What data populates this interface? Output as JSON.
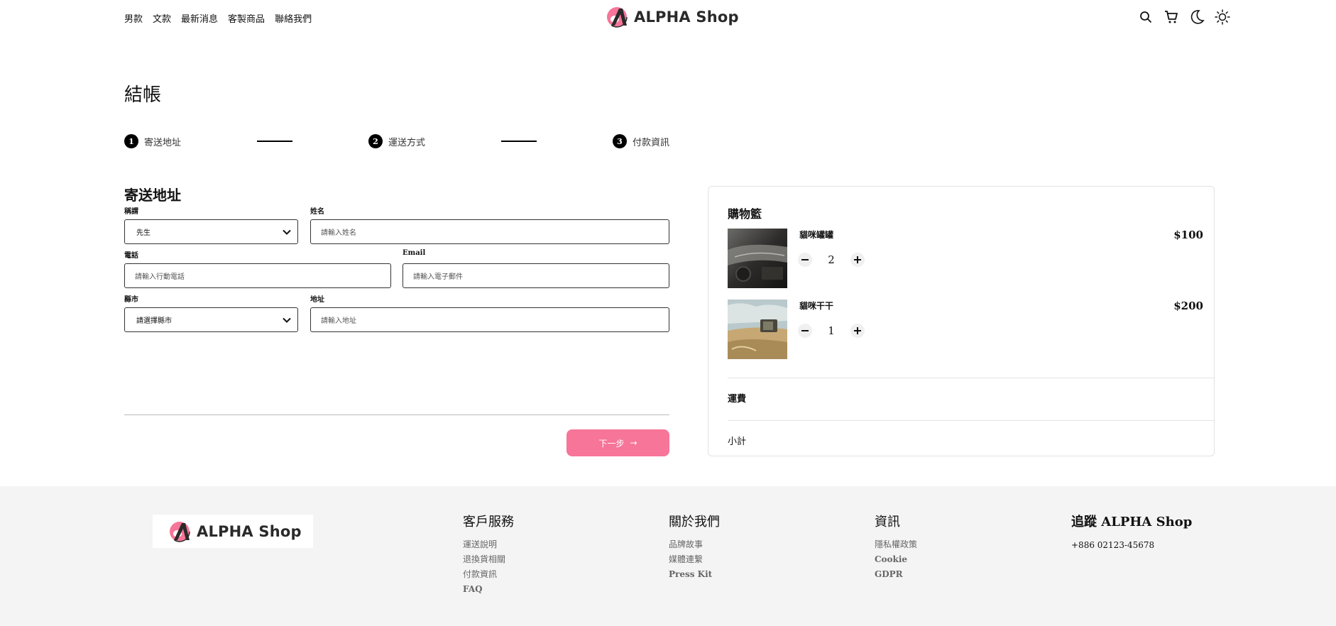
{
  "header": {
    "nav": [
      "男款",
      "文款",
      "最新消息",
      "客製商品",
      "聯絡我們"
    ],
    "brand": "ALPHA Shop",
    "icons": [
      "search-icon",
      "cart-icon",
      "moon-icon",
      "sun-icon"
    ]
  },
  "page_title": "結帳",
  "stepper": {
    "steps": [
      {
        "number": "1",
        "label": "寄送地址"
      },
      {
        "number": "2",
        "label": "運送方式"
      },
      {
        "number": "3",
        "label": "付款資訊"
      }
    ]
  },
  "form": {
    "title": "寄送地址",
    "salutation": {
      "label": "稱謂",
      "value": "先生"
    },
    "name": {
      "label": "姓名",
      "placeholder": "請輸入姓名"
    },
    "phone": {
      "label": "電話",
      "placeholder": "請輸入行動電話"
    },
    "email": {
      "label": "Email",
      "placeholder": "請輸入電子郵件"
    },
    "city": {
      "label": "縣市",
      "value": "請選擇縣市"
    },
    "address": {
      "label": "地址",
      "placeholder": "請輸入地址"
    },
    "next_label": "下一步",
    "next_arrow": "→"
  },
  "cart": {
    "title": "購物籃",
    "items": [
      {
        "name": "貓咪罐罐",
        "quantity": "2",
        "price": "$100"
      },
      {
        "name": "貓咪干干",
        "quantity": "1",
        "price": "$200"
      }
    ],
    "shipping_label": "運費",
    "subtotal_label": "小計"
  },
  "footer": {
    "brand": "ALPHA Shop",
    "columns": [
      {
        "title": "客戶服務",
        "links": [
          "運送說明",
          "退換貨相關",
          "付款資訊",
          "FAQ"
        ]
      },
      {
        "title": "關於我們",
        "links": [
          "品牌故事",
          "媒體連繫",
          "Press Kit"
        ]
      },
      {
        "title": "資訊",
        "links": [
          "隱私權政策",
          "Cookie",
          "GDPR"
        ]
      },
      {
        "title": "追蹤 ALPHA Shop",
        "phone": "+886 02123-45678"
      }
    ]
  },
  "colors": {
    "accent": "#f67599",
    "footer_bg": "#f4f4f4"
  }
}
